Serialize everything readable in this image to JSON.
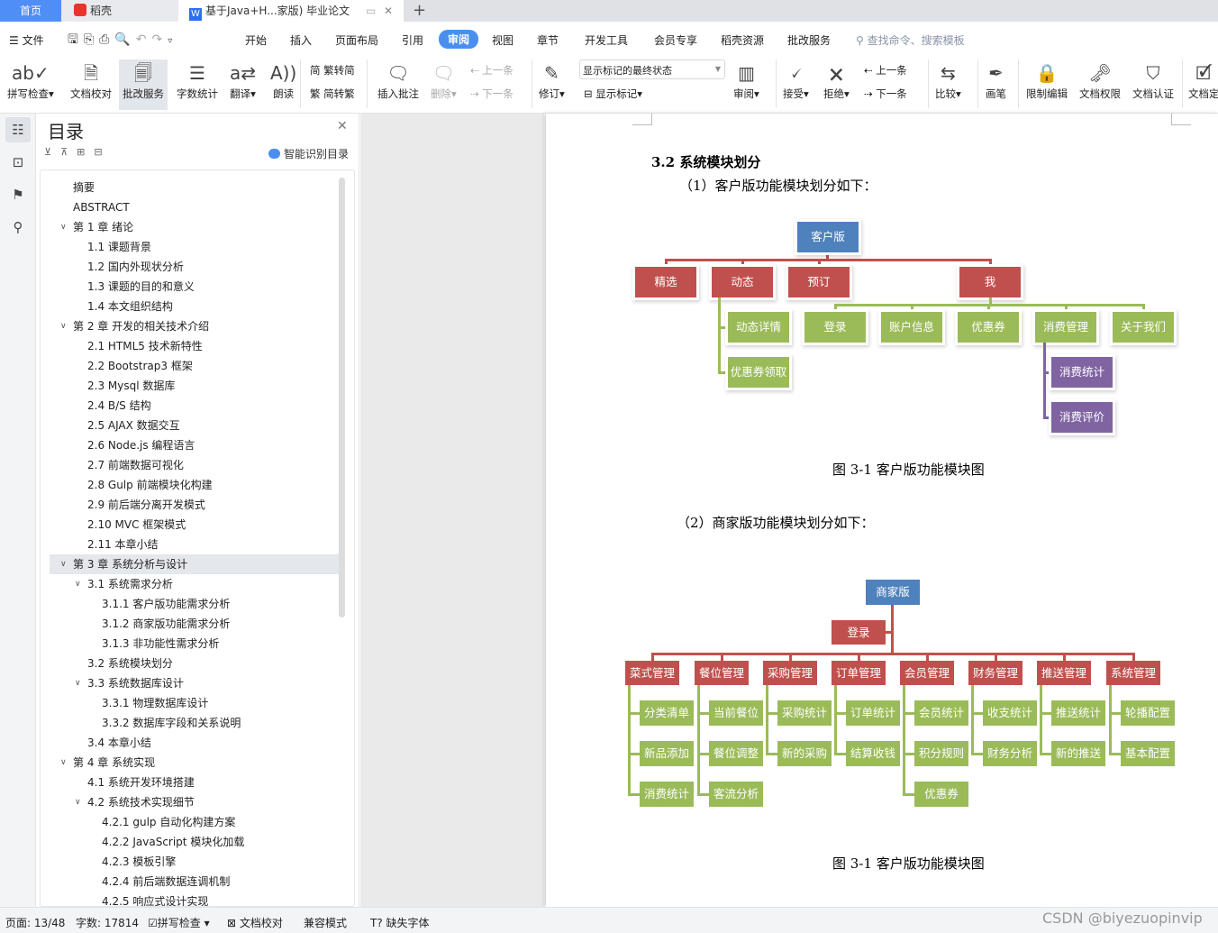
{
  "tabs": {
    "home": "首页",
    "daoke": "稻壳",
    "doc": "基于Java+H...家版)  毕业论文",
    "new_tab": "+"
  },
  "menubar": {
    "file": "文件",
    "items": [
      "开始",
      "插入",
      "页面布局",
      "引用",
      "审阅",
      "视图",
      "章节",
      "开发工具",
      "会员专享",
      "稻壳资源",
      "批改服务"
    ],
    "active": "审阅",
    "search_placeholder": "查找命令、搜索模板"
  },
  "ribbon": {
    "spell": "拼写检查",
    "proof": "文档校对",
    "correct": "批改服务",
    "wordcount": "字数统计",
    "translate": "翻译",
    "read": "朗读",
    "t2s": "繁转简",
    "s2t": "简转繁",
    "insert_comment": "插入批注",
    "delete": "删除",
    "prev_comment": "上一条",
    "next_comment": "下一条",
    "revise": "修订",
    "display_select": "显示标记的最终状态",
    "show_marks": "显示标记",
    "review": "审阅",
    "accept": "接受",
    "reject": "拒绝",
    "prev_change": "上一条",
    "next_change": "下一条",
    "compare": "比较",
    "pen": "画笔",
    "restrict": "限制编辑",
    "permission": "文档权限",
    "certify": "文档认证",
    "finalize": "文档定"
  },
  "toc": {
    "title": "目录",
    "smart": "智能识别目录",
    "selected_index": 19,
    "items": [
      {
        "label": "摘要",
        "level": 0
      },
      {
        "label": "ABSTRACT",
        "level": 0
      },
      {
        "label": "第 1 章  绪论",
        "level": 0,
        "expanded": true
      },
      {
        "label": "1.1  课题背景",
        "level": 1
      },
      {
        "label": "1.2  国内外现状分析",
        "level": 1
      },
      {
        "label": "1.3  课题的目的和意义",
        "level": 1
      },
      {
        "label": "1.4  本文组织结构",
        "level": 1
      },
      {
        "label": "第 2 章  开发的相关技术介绍",
        "level": 0,
        "expanded": true
      },
      {
        "label": "2.1 HTML5 技术新特性",
        "level": 1
      },
      {
        "label": "2.2 Bootstrap3 框架",
        "level": 1
      },
      {
        "label": "2.3 Mysql 数据库",
        "level": 1
      },
      {
        "label": "2.4 B/S 结构",
        "level": 1
      },
      {
        "label": "2.5 AJAX 数据交互",
        "level": 1
      },
      {
        "label": "2.6 Node.js 编程语言",
        "level": 1
      },
      {
        "label": "2.7 前端数据可视化",
        "level": 1
      },
      {
        "label": "2.8 Gulp 前端模块化构建",
        "level": 1
      },
      {
        "label": "2.9 前后端分离开发模式",
        "level": 1
      },
      {
        "label": "2.10 MVC 框架模式",
        "level": 1
      },
      {
        "label": "2.11  本章小结",
        "level": 1
      },
      {
        "label": "第 3 章  系统分析与设计",
        "level": 0,
        "expanded": true
      },
      {
        "label": "3.1  系统需求分析",
        "level": 1,
        "expanded": true
      },
      {
        "label": "3.1.1  客户版功能需求分析",
        "level": 2
      },
      {
        "label": "3.1.2  商家版功能需求分析",
        "level": 2
      },
      {
        "label": "3.1.3  非功能性需求分析",
        "level": 2
      },
      {
        "label": "3.2  系统模块划分",
        "level": 1
      },
      {
        "label": "3.3  系统数据库设计",
        "level": 1,
        "expanded": true
      },
      {
        "label": "3.3.1 物理数据库设计",
        "level": 2
      },
      {
        "label": "3.3.2  数据库字段和关系说明",
        "level": 2
      },
      {
        "label": "3.4  本章小结",
        "level": 1
      },
      {
        "label": "第 4 章  系统实现",
        "level": 0,
        "expanded": true
      },
      {
        "label": "4.1  系统开发环境搭建",
        "level": 1
      },
      {
        "label": "4.2  系统技术实现细节",
        "level": 1,
        "expanded": true
      },
      {
        "label": "4.2.1 gulp 自动化构建方案",
        "level": 2
      },
      {
        "label": "4.2.2 JavaScript 模块化加载",
        "level": 2
      },
      {
        "label": "4.2.3  模板引擎",
        "level": 2
      },
      {
        "label": "4.2.4  前后端数据连调机制",
        "level": 2
      },
      {
        "label": "4.2.5  响应式设计实现",
        "level": 2
      }
    ]
  },
  "document": {
    "heading": "3.2  系统模块划分",
    "para1": "（1）客户版功能模块划分如下：",
    "caption1": "图  3-1   客户版功能模块图",
    "para2": "（2）商家版功能模块划分如下：",
    "caption2": "图  3-1   客户版功能模块图",
    "diagram1": {
      "root": "客户版",
      "level1": [
        "精选",
        "动态",
        "预订",
        "我"
      ],
      "dongtai_children": [
        "动态详情",
        "优惠券领取"
      ],
      "wo_children": [
        "登录",
        "账户信息",
        "优惠券",
        "消费管理",
        "关于我们"
      ],
      "xiaofei_children": [
        "消费统计",
        "消费评价"
      ]
    },
    "diagram2": {
      "root": "商家版",
      "login": "登录",
      "modules": [
        {
          "name": "菜式管理",
          "children": [
            "分类清单",
            "新品添加",
            "消费统计"
          ]
        },
        {
          "name": "餐位管理",
          "children": [
            "当前餐位",
            "餐位调整",
            "客流分析"
          ]
        },
        {
          "name": "采购管理",
          "children": [
            "采购统计",
            "新的采购"
          ]
        },
        {
          "name": "订单管理",
          "children": [
            "订单统计",
            "结算收钱"
          ]
        },
        {
          "name": "会员管理",
          "children": [
            "会员统计",
            "积分规则",
            "优惠券"
          ]
        },
        {
          "name": "财务管理",
          "children": [
            "收支统计",
            "财务分析"
          ]
        },
        {
          "name": "推送管理",
          "children": [
            "推送统计",
            "新的推送"
          ]
        },
        {
          "name": "系统管理",
          "children": [
            "轮播配置",
            "基本配置"
          ]
        }
      ]
    }
  },
  "colors": {
    "blue": "#4f81bd",
    "red": "#c0504d",
    "green": "#9bbb59",
    "purple": "#8064a2",
    "accent": "#4a8ff0"
  },
  "status": {
    "page": "页面: 13/48",
    "words": "字数: 17814",
    "spell": "拼写检查",
    "proof": "文档校对",
    "compat": "兼容模式",
    "missing_font": "缺失字体"
  },
  "watermark": "CSDN @biyezuopinvip"
}
